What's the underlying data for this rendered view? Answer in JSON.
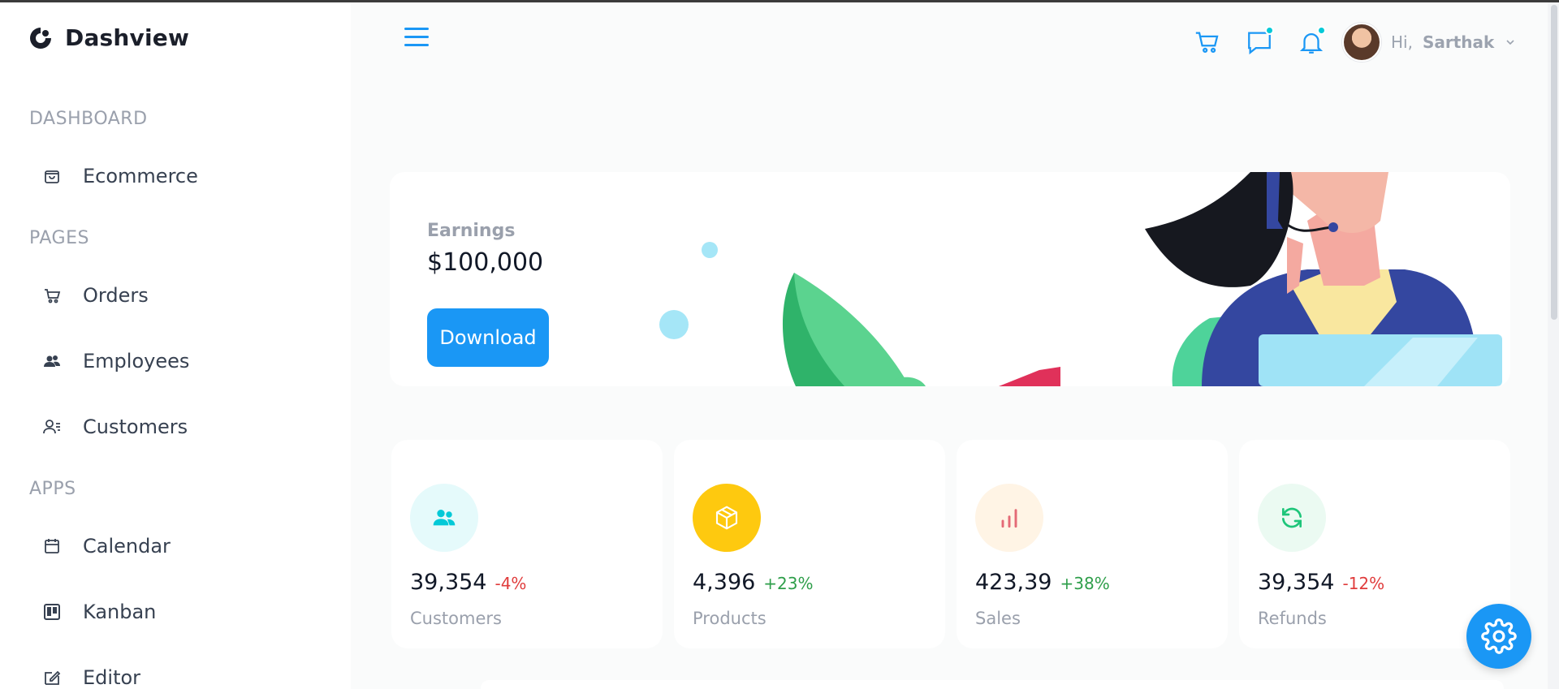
{
  "brand": {
    "name": "Dashview",
    "logo_icon": "brand-logo-icon"
  },
  "sidebar": {
    "sections": [
      {
        "title": "DASHBOARD",
        "items": [
          {
            "label": "Ecommerce",
            "icon": "shopping-bag-icon"
          }
        ]
      },
      {
        "title": "PAGES",
        "items": [
          {
            "label": "Orders",
            "icon": "cart-icon"
          },
          {
            "label": "Employees",
            "icon": "users-icon"
          },
          {
            "label": "Customers",
            "icon": "user-list-icon"
          }
        ]
      },
      {
        "title": "APPS",
        "items": [
          {
            "label": "Calendar",
            "icon": "calendar-icon"
          },
          {
            "label": "Kanban",
            "icon": "kanban-icon"
          },
          {
            "label": "Editor",
            "icon": "edit-icon"
          }
        ]
      }
    ]
  },
  "header": {
    "menu_icon": "hamburger-icon",
    "icons": [
      "cart-icon",
      "chat-icon",
      "bell-icon"
    ],
    "greeting": "Hi,",
    "username": "Sarthak"
  },
  "earnings": {
    "label": "Earnings",
    "value": "$100,000",
    "button": "Download"
  },
  "stats": [
    {
      "amount": "39,354",
      "change": "-4%",
      "change_color": "#e03c3c",
      "label": "Customers",
      "icon": "people-icon",
      "icon_color": "#03c9d7",
      "bg": "#e5fafb"
    },
    {
      "amount": "4,396",
      "change": "+23%",
      "change_color": "#2e9e4a",
      "label": "Products",
      "icon": "box-icon",
      "icon_color": "#ffffff",
      "bg": "#fec90f"
    },
    {
      "amount": "423,39",
      "change": "+38%",
      "change_color": "#2e9e4a",
      "label": "Sales",
      "icon": "bar-chart-icon",
      "icon_color": "#e46a76",
      "bg": "#fff4e5"
    },
    {
      "amount": "39,354",
      "change": "-12%",
      "change_color": "#e03c3c",
      "label": "Refunds",
      "icon": "refresh-icon",
      "icon_color": "#1ec57a",
      "bg": "#ebfaf2"
    }
  ],
  "colors": {
    "accent": "#1a97f5",
    "notify_dot": "#03c9d7"
  },
  "settings_icon": "gear-icon"
}
